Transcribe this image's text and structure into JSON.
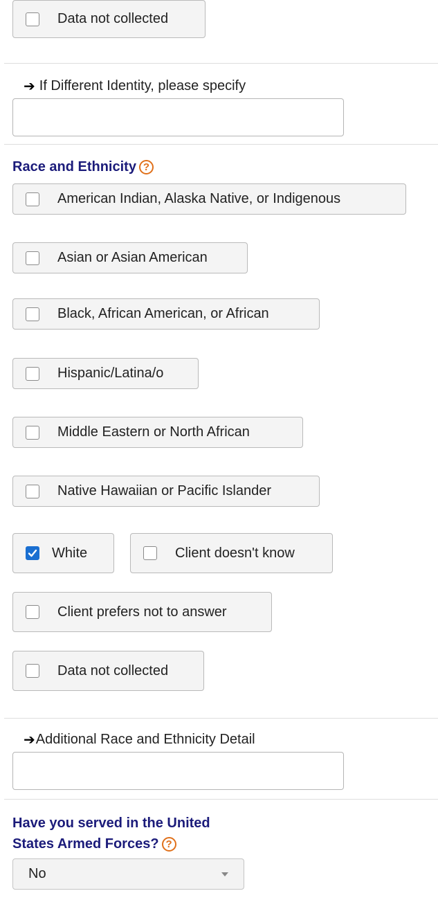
{
  "gender_section": {
    "data_not_collected": "Data not collected",
    "different_identity_label": "If Different Identity, please specify",
    "different_identity_value": ""
  },
  "race": {
    "heading": "Race and Ethnicity",
    "help_icon": "question-circle-icon",
    "options": [
      {
        "label": "American Indian, Alaska Native, or Indigenous",
        "checked": false
      },
      {
        "label": "Asian or Asian American",
        "checked": false
      },
      {
        "label": "Black, African American, or African",
        "checked": false
      },
      {
        "label": "Hispanic/Latina/o",
        "checked": false
      },
      {
        "label": "Middle Eastern or North African",
        "checked": false
      },
      {
        "label": "Native Hawaiian or Pacific Islander",
        "checked": false
      },
      {
        "label": "White",
        "checked": true
      },
      {
        "label": "Client doesn't know",
        "checked": false
      },
      {
        "label": "Client prefers not to answer",
        "checked": false
      },
      {
        "label": "Data not collected",
        "checked": false
      }
    ],
    "additional_label": "Additional Race and Ethnicity Detail",
    "additional_value": ""
  },
  "veteran": {
    "heading_line1": "Have you served in the United",
    "heading_line2": "States Armed Forces?",
    "help_icon": "question-circle-icon",
    "selected": "No"
  },
  "colors": {
    "heading": "#1b1b7a",
    "help_accent": "#e0701a",
    "checkbox_checked": "#1a6fd1"
  }
}
